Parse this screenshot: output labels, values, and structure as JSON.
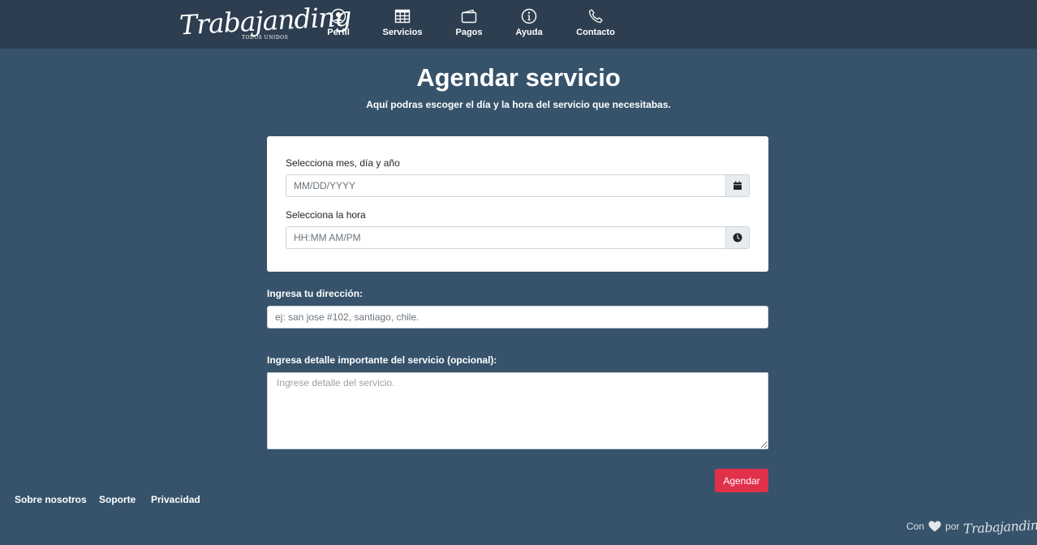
{
  "brand": {
    "name": "Trabajanding",
    "tagline": "TODOS UNIDOS"
  },
  "nav": {
    "items": [
      {
        "label": "Perfil",
        "icon": "user-circle-icon"
      },
      {
        "label": "Servicios",
        "icon": "table-grid-icon"
      },
      {
        "label": "Pagos",
        "icon": "wallet-icon"
      },
      {
        "label": "Ayuda",
        "icon": "info-circle-icon"
      },
      {
        "label": "Contacto",
        "icon": "phone-icon"
      }
    ]
  },
  "page": {
    "title": "Agendar servicio",
    "subtitle": "Aquí podras escoger el día y la hora del servicio que necesitabas."
  },
  "schedule": {
    "date_label": "Selecciona mes, día y año",
    "date_placeholder": "MM/DD/YYYY",
    "date_icon": "calendar-icon",
    "time_label": "Selecciona la hora",
    "time_placeholder": "HH:MM AM/PM",
    "time_icon": "clock-icon"
  },
  "address": {
    "label": "Ingresa tu dirección:",
    "placeholder": "ej: san jose #102, santiago, chile."
  },
  "details": {
    "label": "Ingresa detalle importante del servicio (opcional):",
    "placeholder": "Ingrese detalle del servicio."
  },
  "actions": {
    "submit_label": "Agendar"
  },
  "footer": {
    "links": [
      "Sobre nosotros",
      "Soporte",
      "Privacidad"
    ],
    "credit_prefix": "Con",
    "credit_icon": "heart-icon",
    "credit_middle": "por",
    "credit_brand": "Trabajanding"
  },
  "colors": {
    "background": "#36536b",
    "navbar": "#2c3e4f",
    "accent_button": "#e1304a"
  }
}
